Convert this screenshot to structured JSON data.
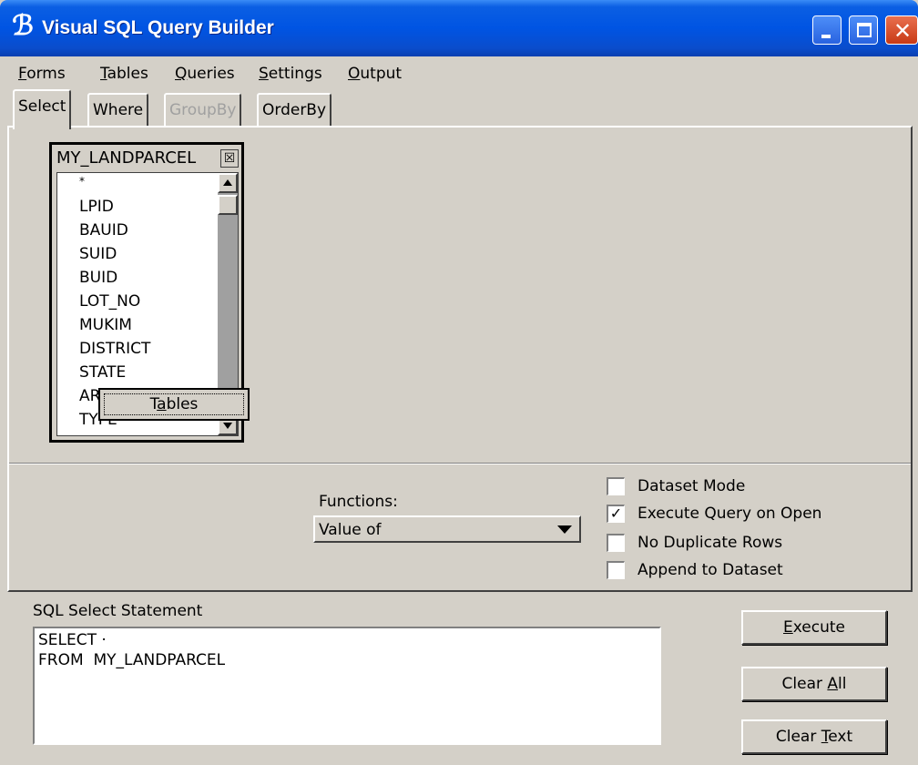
{
  "window": {
    "title": "Visual SQL Query Builder",
    "app_icon": "script-b-icon",
    "titlebar_color": "#0054e3"
  },
  "menu": {
    "items": [
      {
        "label": "Forms"
      },
      {
        "label": "Tables"
      },
      {
        "label": "Queries"
      },
      {
        "label": "Settings"
      },
      {
        "label": "Output"
      }
    ]
  },
  "tabs": [
    {
      "label": "Select",
      "state": "active"
    },
    {
      "label": "Where",
      "state": "enabled"
    },
    {
      "label": "GroupBy",
      "state": "disabled"
    },
    {
      "label": "OrderBy",
      "state": "enabled"
    }
  ],
  "table_box": {
    "title": "MY_LANDPARCEL",
    "close_glyph": "☒",
    "fields": [
      "*",
      "LPID",
      "BAUID",
      "SUID",
      "BUID",
      "LOT_NO",
      "MUKIM",
      "DISTRICT",
      "STATE",
      "AREA",
      "TYPE"
    ]
  },
  "tables_button": {
    "pre": "T",
    "accel": "a",
    "post": "bles"
  },
  "functions": {
    "label": "Functions:",
    "selected": "Value of"
  },
  "options": [
    {
      "label": "Dataset Mode",
      "checked": false
    },
    {
      "label": "Execute Query on Open",
      "checked": true
    },
    {
      "label": "No Duplicate Rows",
      "checked": false
    },
    {
      "label": "Append to Dataset",
      "checked": false
    }
  ],
  "sql": {
    "label": "SQL Select Statement",
    "text": "SELECT ·\nFROM  MY_LANDPARCEL"
  },
  "buttons": {
    "execute": {
      "accel": "E",
      "post": "xecute"
    },
    "clear_all": {
      "pre": "Clear ",
      "accel": "A",
      "post": "ll"
    },
    "clear_text": {
      "pre": "Clear ",
      "accel": "T",
      "post": "ext"
    }
  }
}
